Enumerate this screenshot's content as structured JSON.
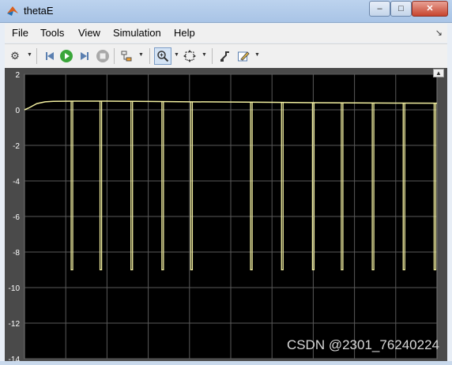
{
  "window": {
    "title": "thetaE"
  },
  "window_controls": {
    "minimize": "–",
    "maximize": "□",
    "close": "✕"
  },
  "menu": [
    "File",
    "Tools",
    "View",
    "Simulation",
    "Help"
  ],
  "toolbar": {
    "buttons": [
      "settings-icon",
      "step-back-icon",
      "run-icon",
      "step-forward-icon",
      "stop-icon",
      "highlight-block-icon",
      "zoom-icon",
      "fit-to-view-icon",
      "autoscale-icon",
      "style-icon"
    ]
  },
  "colors": {
    "plot_bg": "#000000",
    "frame": "#4a4a4a",
    "signal": "#f2efa0",
    "grid": "#5a5a5a",
    "tick_text": "#ffffff"
  },
  "chart_data": {
    "type": "line",
    "title": "",
    "xlabel": "",
    "ylabel": "",
    "ylim": [
      -14,
      2
    ],
    "yticks": [
      2,
      0,
      -2,
      -4,
      -6,
      -8,
      -10,
      -12,
      -14
    ],
    "grid": true,
    "xlim": [
      0,
      10
    ],
    "series": [
      {
        "color": "#f2efa0",
        "x": [
          0,
          0.1,
          0.3,
          0.5,
          0.7,
          1.2,
          2.0,
          3.0,
          4.0,
          5.0,
          6.0,
          7.0,
          8.0,
          9.0,
          10.0
        ],
        "y": [
          0,
          0.1,
          0.35,
          0.45,
          0.48,
          0.49,
          0.49,
          0.47,
          0.45,
          0.44,
          0.42,
          0.4,
          0.39,
          0.38,
          0.37
        ],
        "spike_x": [
          1.15,
          1.85,
          2.6,
          3.35,
          4.05,
          5.5,
          6.25,
          7.0,
          7.7,
          8.45,
          9.2,
          9.95
        ],
        "spike_min": -9
      }
    ]
  },
  "watermark": "CSDN @2301_76240224"
}
